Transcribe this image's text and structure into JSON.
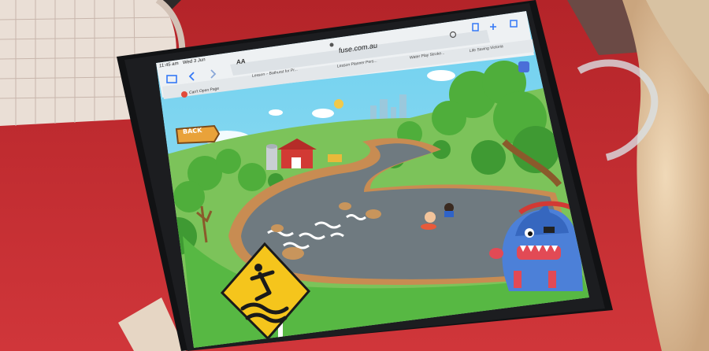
{
  "status_bar": {
    "time": "11:45 am",
    "date": "Wed 3 Jun"
  },
  "browser": {
    "address_text_size": "AA",
    "url": "fuse.com.au",
    "tabs": [
      {
        "label": "Lesson – Bathurst for Pr..."
      },
      {
        "label": "Lesson Planner Pers..."
      },
      {
        "label": "Water Play Stroke..."
      },
      {
        "label": "Life Saving Victoria"
      }
    ],
    "bookmarks": [
      {
        "label": "Can't Open Page"
      }
    ]
  },
  "game": {
    "back_label": "BACK"
  },
  "colors": {
    "table": "#b8242a",
    "sky": "#5ec8ec",
    "grass": "#57b843",
    "water": "#737d82",
    "sign": "#f5c51c"
  },
  "icons": [
    "sidebar-icon",
    "back-arrow-icon",
    "forward-arrow-icon",
    "reader-icon",
    "mic-icon",
    "share-icon",
    "add-tab-icon",
    "tabs-icon",
    "page-menu-icon"
  ]
}
